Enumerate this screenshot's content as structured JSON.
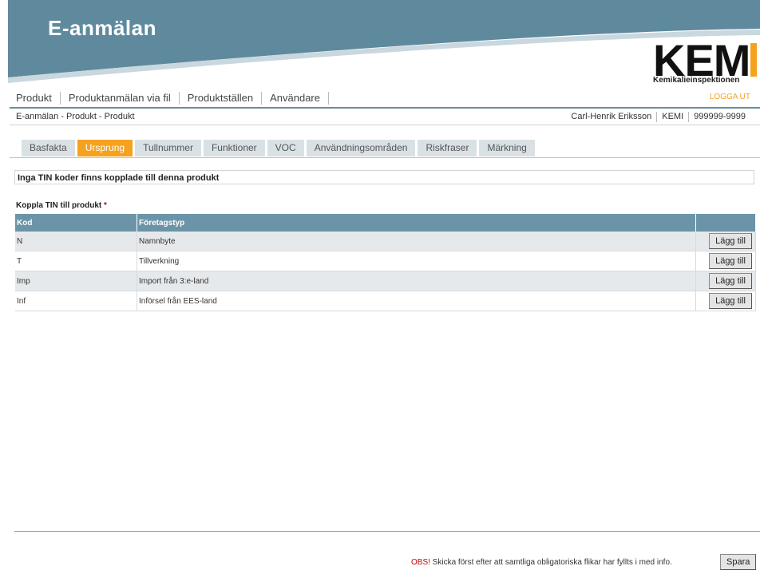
{
  "header": {
    "app_title": "E-anmälan",
    "logo_text": "KEM",
    "logo_subtitle": "Kemikalieinspektionen",
    "colors": {
      "band": "#5f8a9e",
      "accent": "#f5a21e"
    }
  },
  "nav": {
    "items": [
      "Produkt",
      "Produktanmälan via fil",
      "Produktställen",
      "Användare"
    ],
    "logout": "LOGGA UT"
  },
  "breadcrumb": "E-anmälan - Produkt - Produkt",
  "user": {
    "name": "Carl-Henrik Eriksson",
    "org": "KEMI",
    "number": "999999-9999"
  },
  "tabs": [
    {
      "label": "Basfakta"
    },
    {
      "label": "Ursprung",
      "active": true
    },
    {
      "label": "Tullnummer"
    },
    {
      "label": "Funktioner"
    },
    {
      "label": "VOC"
    },
    {
      "label": "Användningsområden"
    },
    {
      "label": "Riskfraser"
    },
    {
      "label": "Märkning"
    }
  ],
  "info_message": "Inga TIN koder finns kopplade till denna produkt",
  "section": {
    "title": "Koppla TIN till produkt",
    "required_mark": "*"
  },
  "table": {
    "columns": [
      "Kod",
      "Företagstyp",
      ""
    ],
    "rows": [
      {
        "kod": "N",
        "typ": "Namnbyte",
        "action": "Lägg till"
      },
      {
        "kod": "T",
        "typ": "Tillverkning",
        "action": "Lägg till"
      },
      {
        "kod": "Imp",
        "typ": "Import från 3:e-land",
        "action": "Lägg till"
      },
      {
        "kod": "Inf",
        "typ": "Införsel från EES-land",
        "action": "Lägg till"
      }
    ]
  },
  "footer": {
    "obs": "OBS!",
    "note": " Skicka först efter att samtliga obligatoriska flikar har fyllts i med info.",
    "save_label": "Spara"
  }
}
